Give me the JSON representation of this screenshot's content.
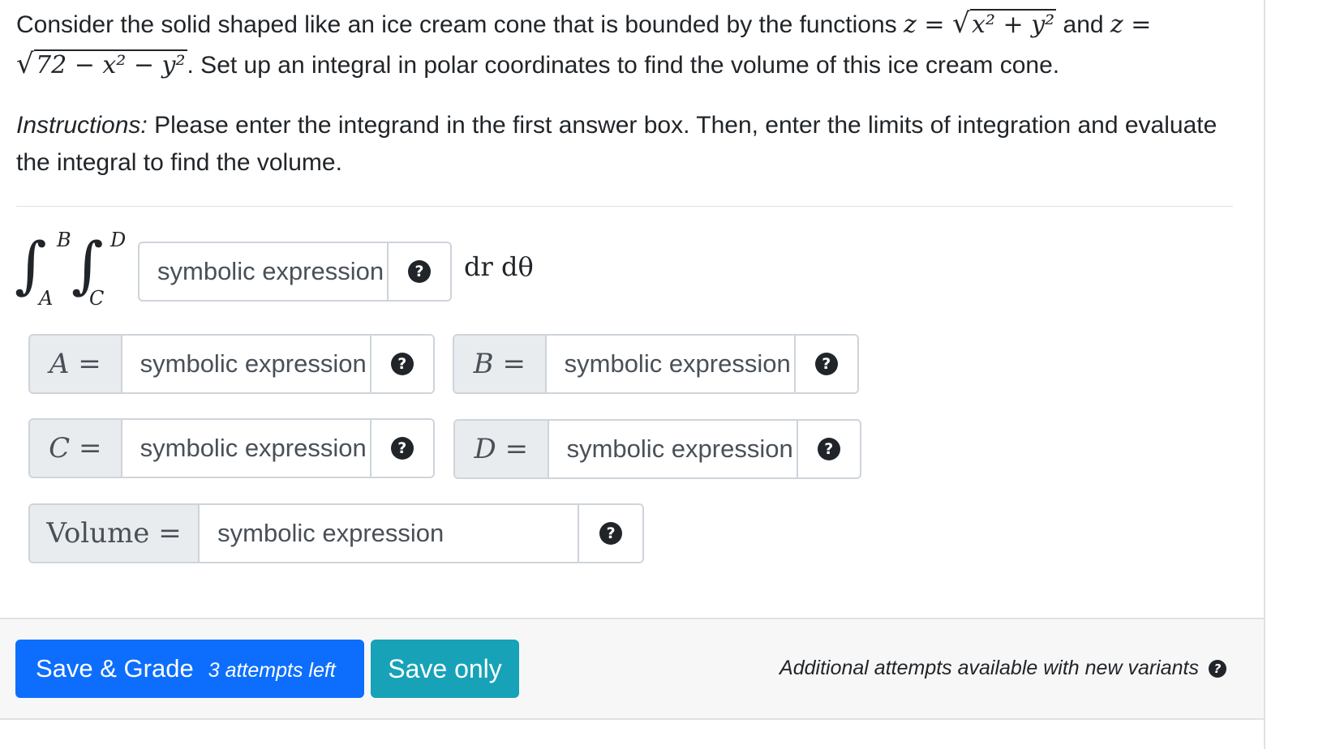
{
  "problem": {
    "text1": "Consider the solid shaped like an ice cream cone that is bounded by the functions ",
    "eq1_lhs": "z =",
    "eq1_rad": "x² + y²",
    "text2": " and",
    "eq2_lhs": "z =",
    "eq2_rad": "72 − x² − y²",
    "text3": ". Set up an integral in polar coordinates to find the volume of this ice cream cone.",
    "instructions_label": "Instructions:",
    "instructions_text": " Please enter the integrand in the first answer box. Then, enter the limits of integration and evaluate the integral to find the volume."
  },
  "integral": {
    "outer_upper": "B",
    "outer_lower": "A",
    "inner_upper": "D",
    "inner_lower": "C",
    "differential": "dr dθ",
    "integrand_placeholder": "symbolic expression"
  },
  "fields": {
    "A": {
      "label": "A =",
      "placeholder": "symbolic expression"
    },
    "B": {
      "label": "B =",
      "placeholder": "symbolic expression"
    },
    "C": {
      "label": "C =",
      "placeholder": "symbolic expression"
    },
    "D": {
      "label": "D =",
      "placeholder": "symbolic expression"
    },
    "volume": {
      "label": "Volume =",
      "placeholder": "symbolic expression"
    }
  },
  "help_icon": "?",
  "footer": {
    "grade_label": "Save & Grade",
    "attempts": "3 attempts left",
    "save_label": "Save only",
    "additional": "Additional attempts available with new variants"
  }
}
